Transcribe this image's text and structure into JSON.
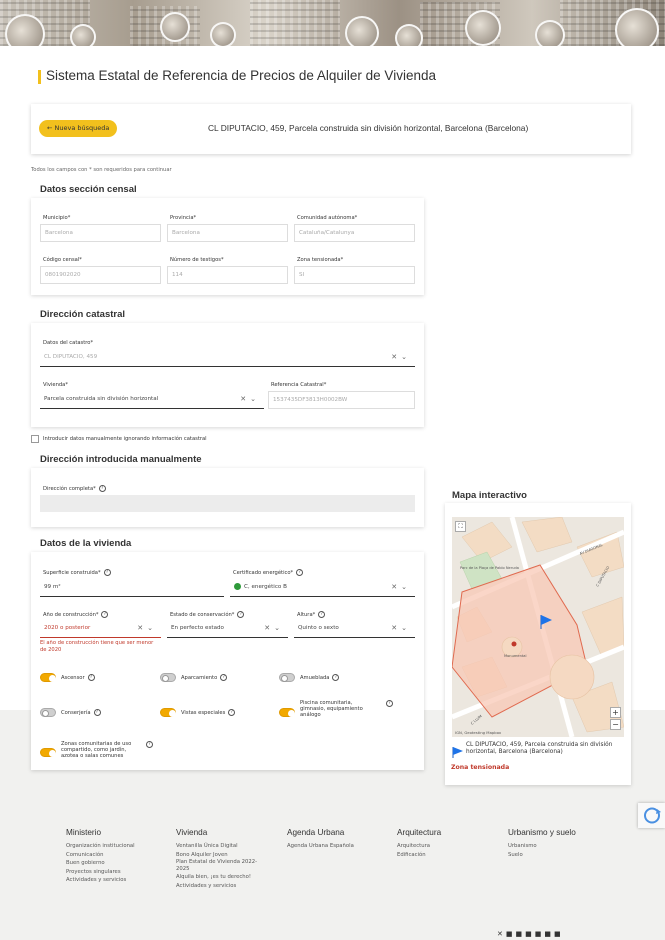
{
  "header": {
    "title": "Sistema Estatal de Referencia de Precios de Alquiler de Vivienda"
  },
  "search": {
    "new_search_label": "Nueva búsqueda",
    "address": "CL DIPUTACIO, 459, Parcela construida sin división horizontal, Barcelona (Barcelona)"
  },
  "required_note": "Todos los campos con * son requeridos para continuar",
  "censal": {
    "title": "Datos sección censal",
    "fields": [
      {
        "label": "Municipio*",
        "value": "Barcelona"
      },
      {
        "label": "Provincia*",
        "value": "Barcelona"
      },
      {
        "label": "Comunidad autónoma*",
        "value": "Cataluña/Catalunya"
      },
      {
        "label": "Código censal*",
        "value": "0801902020"
      },
      {
        "label": "Número de testigos*",
        "value": "114"
      },
      {
        "label": "Zona tensionada*",
        "value": "SI"
      }
    ]
  },
  "catastral": {
    "title": "Dirección catastral",
    "datos_label": "Datos del catastro*",
    "datos_value": "CL DIPUTACIO, 459",
    "vivienda_label": "Vivienda*",
    "vivienda_value": "Parcela construida sin división horizontal",
    "ref_label": "Referencia Catastral*",
    "ref_value": "1537435DF3813H0002BW"
  },
  "manual_checkbox": "Introducir datos manualmente ignorando información catastral",
  "manual": {
    "title": "Dirección introducida manualmente",
    "label": "Dirección completa*"
  },
  "vivienda": {
    "title": "Datos de la vivienda",
    "superficie_label": "Superficie construida*",
    "superficie_value": "99  m²",
    "certificado_label": "Certificado energético*",
    "certificado_value": "C, energético B",
    "anio_label": "Año de construcción*",
    "anio_value": "2020 o posterior",
    "anio_error": "El año de construcción tiene que ser menor de 2020",
    "estado_label": "Estado de conservación*",
    "estado_value": "En perfecto estado",
    "altura_label": "Altura*",
    "altura_value": "Quinto o sexto",
    "toggles": [
      {
        "label": "Ascensor",
        "on": true
      },
      {
        "label": "Aparcamiento",
        "on": false
      },
      {
        "label": "Amueblada",
        "on": false
      },
      {
        "label": "Conserjería",
        "on": false
      },
      {
        "label": "Vistas especiales",
        "on": true
      },
      {
        "label": "Piscina comunitaria, gimnasio, equipamiento análogo",
        "on": true
      },
      {
        "label": "Zonas comunitarias de uso compartido, como jardín, azotea o salas comunes",
        "on": true
      }
    ]
  },
  "map": {
    "title": "Mapa interactivo",
    "park_label": "Parc de la Plaça de Pablo Neruda",
    "street_1": "AV DIAGONAL",
    "street_2": "C DIPUTACIO",
    "street_3": "C LLUM",
    "metro_label": "Monumental",
    "attribution": "IGN, Geotesting Mapbox",
    "legend": "CL DIPUTACIO, 459, Parcela construida sin división horizontal, Barcelona (Barcelona)",
    "zona": "Zona tensionada"
  },
  "footer": {
    "columns": [
      {
        "head": "Ministerio",
        "links": [
          "Organización institucional",
          "Comunicación",
          "Buen gobierno",
          "Proyectos singulares",
          "Actividades y servicios"
        ]
      },
      {
        "head": "Vivienda",
        "links": [
          "Ventanilla Única Digital",
          "Bono Alquiler Joven",
          "Plan Estatal de Vivienda 2022-",
          "2025",
          "Alquila bien, ¡es tu derecho!",
          "Actividades y servicios"
        ]
      },
      {
        "head": "Agenda Urbana",
        "links": [
          "Agenda Urbana Española"
        ]
      },
      {
        "head": "Arquitectura",
        "links": [
          "Arquitectura",
          "Edificación"
        ]
      },
      {
        "head": "Urbanismo y suelo",
        "links": [
          "Urbanismo",
          "Suelo"
        ]
      }
    ]
  }
}
